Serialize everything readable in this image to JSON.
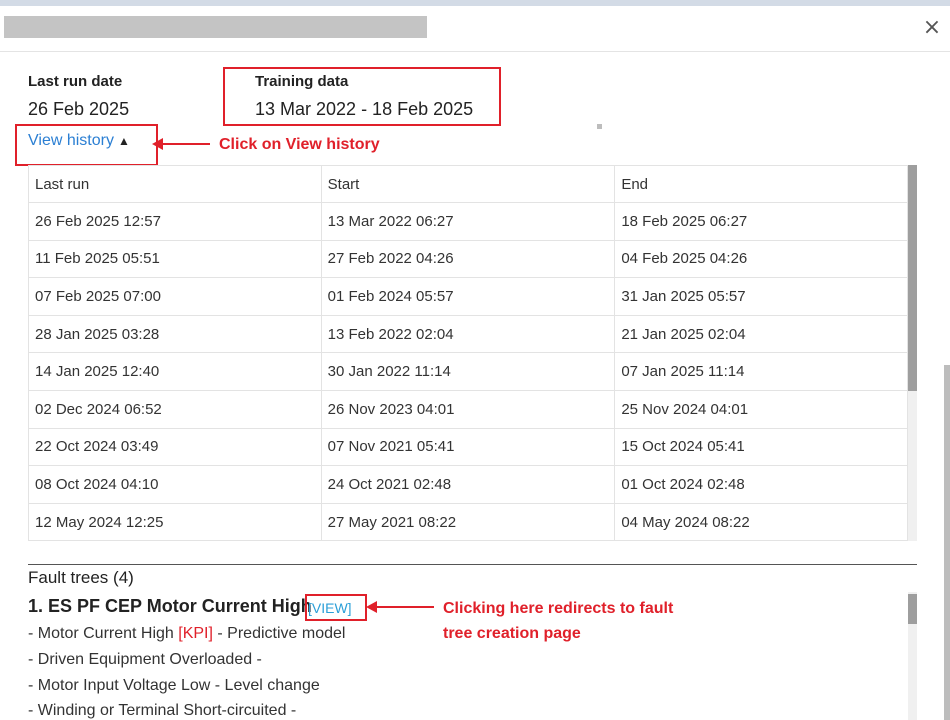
{
  "header": {
    "close_label": "×"
  },
  "summary": {
    "last_run_label": "Last run date",
    "last_run_value": "26 Feb 2025",
    "training_label": "Training data",
    "training_value": "13 Mar 2022 - 18 Feb 2025"
  },
  "history": {
    "toggle_label": "View history",
    "columns": [
      "Last run",
      "Start",
      "End"
    ],
    "rows": [
      [
        "26 Feb 2025 12:57",
        "13 Mar 2022 06:27",
        "18 Feb 2025 06:27"
      ],
      [
        "11 Feb 2025 05:51",
        "27 Feb 2022 04:26",
        "04 Feb 2025 04:26"
      ],
      [
        "07 Feb 2025 07:00",
        "01 Feb 2024 05:57",
        "31 Jan 2025 05:57"
      ],
      [
        "28 Jan 2025 03:28",
        "13 Feb 2022 02:04",
        "21 Jan 2025 02:04"
      ],
      [
        "14 Jan 2025 12:40",
        "30 Jan 2022 11:14",
        "07 Jan 2025 11:14"
      ],
      [
        "02 Dec 2024 06:52",
        "26 Nov 2023 04:01",
        "25 Nov 2024 04:01"
      ],
      [
        "22 Oct 2024 03:49",
        "07 Nov 2021 05:41",
        "15 Oct 2024 05:41"
      ],
      [
        "08 Oct 2024 04:10",
        "24 Oct 2021 02:48",
        "01 Oct 2024 02:48"
      ],
      [
        "12 May 2024 12:25",
        "27 May 2021 08:22",
        "04 May 2024 08:22"
      ]
    ]
  },
  "annotations": {
    "view_history": "Click on View history",
    "fault_view_line1": "Clicking here redirects to fault",
    "fault_view_line2": "tree creation page"
  },
  "fault_trees": {
    "heading": "Fault trees (4)",
    "first_title": "1. ES PF CEP Motor Current High",
    "view_label": "[VIEW]",
    "items": [
      {
        "prefix": "- Motor Current High ",
        "kpi": "[KPI]",
        "suffix": " - Predictive model"
      },
      {
        "prefix": "- Driven Equipment Overloaded -",
        "kpi": "",
        "suffix": ""
      },
      {
        "prefix": "- Motor Input Voltage Low - Level change",
        "kpi": "",
        "suffix": ""
      },
      {
        "prefix": "- Winding or Terminal Short-circuited -",
        "kpi": "",
        "suffix": ""
      }
    ]
  },
  "colors": {
    "link": "#2b7fd3",
    "annotation_red": "#e0202a"
  }
}
